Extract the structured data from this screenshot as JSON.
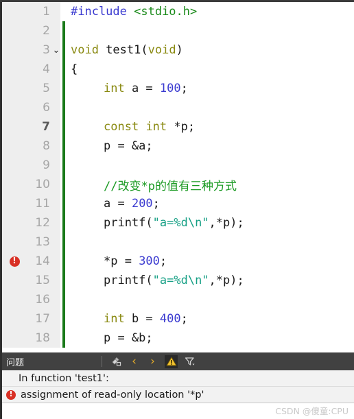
{
  "editor": {
    "gutter_bg": "#eeeeee",
    "changebar_color": "#1a7a1a",
    "error_marker_color": "#d93025",
    "fold_icon": "chevron-down-icon",
    "fold_glyph": "⌄",
    "lines": [
      {
        "n": "1",
        "bold": false,
        "fold": false,
        "error": false,
        "changed": false,
        "indent": 0,
        "tokens": [
          {
            "t": "#include ",
            "c": "pp"
          },
          {
            "t": "<stdio.h>",
            "c": "hdr"
          }
        ]
      },
      {
        "n": "2",
        "bold": false,
        "fold": false,
        "error": false,
        "changed": true,
        "indent": 0,
        "tokens": []
      },
      {
        "n": "3",
        "bold": false,
        "fold": true,
        "error": false,
        "changed": true,
        "indent": 0,
        "tokens": [
          {
            "t": "void",
            "c": "kw"
          },
          {
            "t": " test1(",
            "c": "plain"
          },
          {
            "t": "void",
            "c": "kw"
          },
          {
            "t": ")",
            "c": "plain"
          }
        ]
      },
      {
        "n": "4",
        "bold": false,
        "fold": false,
        "error": false,
        "changed": true,
        "indent": 0,
        "tokens": [
          {
            "t": "{",
            "c": "plain"
          }
        ]
      },
      {
        "n": "5",
        "bold": false,
        "fold": false,
        "error": false,
        "changed": true,
        "indent": 1,
        "tokens": [
          {
            "t": "int",
            "c": "kw"
          },
          {
            "t": " a = ",
            "c": "plain"
          },
          {
            "t": "100",
            "c": "num"
          },
          {
            "t": ";",
            "c": "plain"
          }
        ]
      },
      {
        "n": "6",
        "bold": false,
        "fold": false,
        "error": false,
        "changed": true,
        "indent": 0,
        "tokens": []
      },
      {
        "n": "7",
        "bold": true,
        "fold": false,
        "error": false,
        "changed": true,
        "indent": 1,
        "tokens": [
          {
            "t": "const",
            "c": "kw"
          },
          {
            "t": " ",
            "c": "plain"
          },
          {
            "t": "int",
            "c": "kw"
          },
          {
            "t": " *p;",
            "c": "plain"
          }
        ]
      },
      {
        "n": "8",
        "bold": false,
        "fold": false,
        "error": false,
        "changed": true,
        "indent": 1,
        "tokens": [
          {
            "t": "p = &a;",
            "c": "plain"
          }
        ]
      },
      {
        "n": "9",
        "bold": false,
        "fold": false,
        "error": false,
        "changed": true,
        "indent": 0,
        "tokens": []
      },
      {
        "n": "10",
        "bold": false,
        "fold": false,
        "error": false,
        "changed": true,
        "indent": 1,
        "tokens": [
          {
            "t": "//改变*p的值有三种方式",
            "c": "com"
          }
        ]
      },
      {
        "n": "11",
        "bold": false,
        "fold": false,
        "error": false,
        "changed": true,
        "indent": 1,
        "tokens": [
          {
            "t": "a = ",
            "c": "plain"
          },
          {
            "t": "200",
            "c": "num"
          },
          {
            "t": ";",
            "c": "plain"
          }
        ]
      },
      {
        "n": "12",
        "bold": false,
        "fold": false,
        "error": false,
        "changed": true,
        "indent": 1,
        "tokens": [
          {
            "t": "printf(",
            "c": "plain"
          },
          {
            "t": "\"a=%d\\n\"",
            "c": "str"
          },
          {
            "t": ",*p);",
            "c": "plain"
          }
        ]
      },
      {
        "n": "13",
        "bold": false,
        "fold": false,
        "error": false,
        "changed": true,
        "indent": 0,
        "tokens": []
      },
      {
        "n": "14",
        "bold": false,
        "fold": false,
        "error": true,
        "changed": true,
        "indent": 1,
        "tokens": [
          {
            "t": "*p = ",
            "c": "plain"
          },
          {
            "t": "300",
            "c": "num"
          },
          {
            "t": ";",
            "c": "plain"
          }
        ]
      },
      {
        "n": "15",
        "bold": false,
        "fold": false,
        "error": false,
        "changed": true,
        "indent": 1,
        "tokens": [
          {
            "t": "printf(",
            "c": "plain"
          },
          {
            "t": "\"a=%d\\n\"",
            "c": "str"
          },
          {
            "t": ",*p);",
            "c": "plain"
          }
        ]
      },
      {
        "n": "16",
        "bold": false,
        "fold": false,
        "error": false,
        "changed": true,
        "indent": 0,
        "tokens": []
      },
      {
        "n": "17",
        "bold": false,
        "fold": false,
        "error": false,
        "changed": true,
        "indent": 1,
        "tokens": [
          {
            "t": "int",
            "c": "kw"
          },
          {
            "t": " b = ",
            "c": "plain"
          },
          {
            "t": "400",
            "c": "num"
          },
          {
            "t": ";",
            "c": "plain"
          }
        ]
      },
      {
        "n": "18",
        "bold": false,
        "fold": false,
        "error": false,
        "changed": true,
        "indent": 1,
        "tokens": [
          {
            "t": "p = &b;",
            "c": "plain"
          }
        ]
      }
    ]
  },
  "panel": {
    "title": "问题",
    "toolbar": [
      {
        "name": "clear-problems-icon",
        "glyph": "",
        "active": false
      },
      {
        "name": "previous-problem-icon",
        "glyph": "‹",
        "active": false
      },
      {
        "name": "next-problem-icon",
        "glyph": "›",
        "active": false
      },
      {
        "name": "warning-filter-icon",
        "glyph": "",
        "active": true
      },
      {
        "name": "filter-icon",
        "glyph": "",
        "active": false
      }
    ],
    "rows": [
      {
        "kind": "group",
        "text": "In function 'test1':"
      },
      {
        "kind": "error",
        "text": "assignment of read-only location '*p'"
      }
    ]
  },
  "watermark": {
    "text": "CSDN @傻童:CPU"
  }
}
